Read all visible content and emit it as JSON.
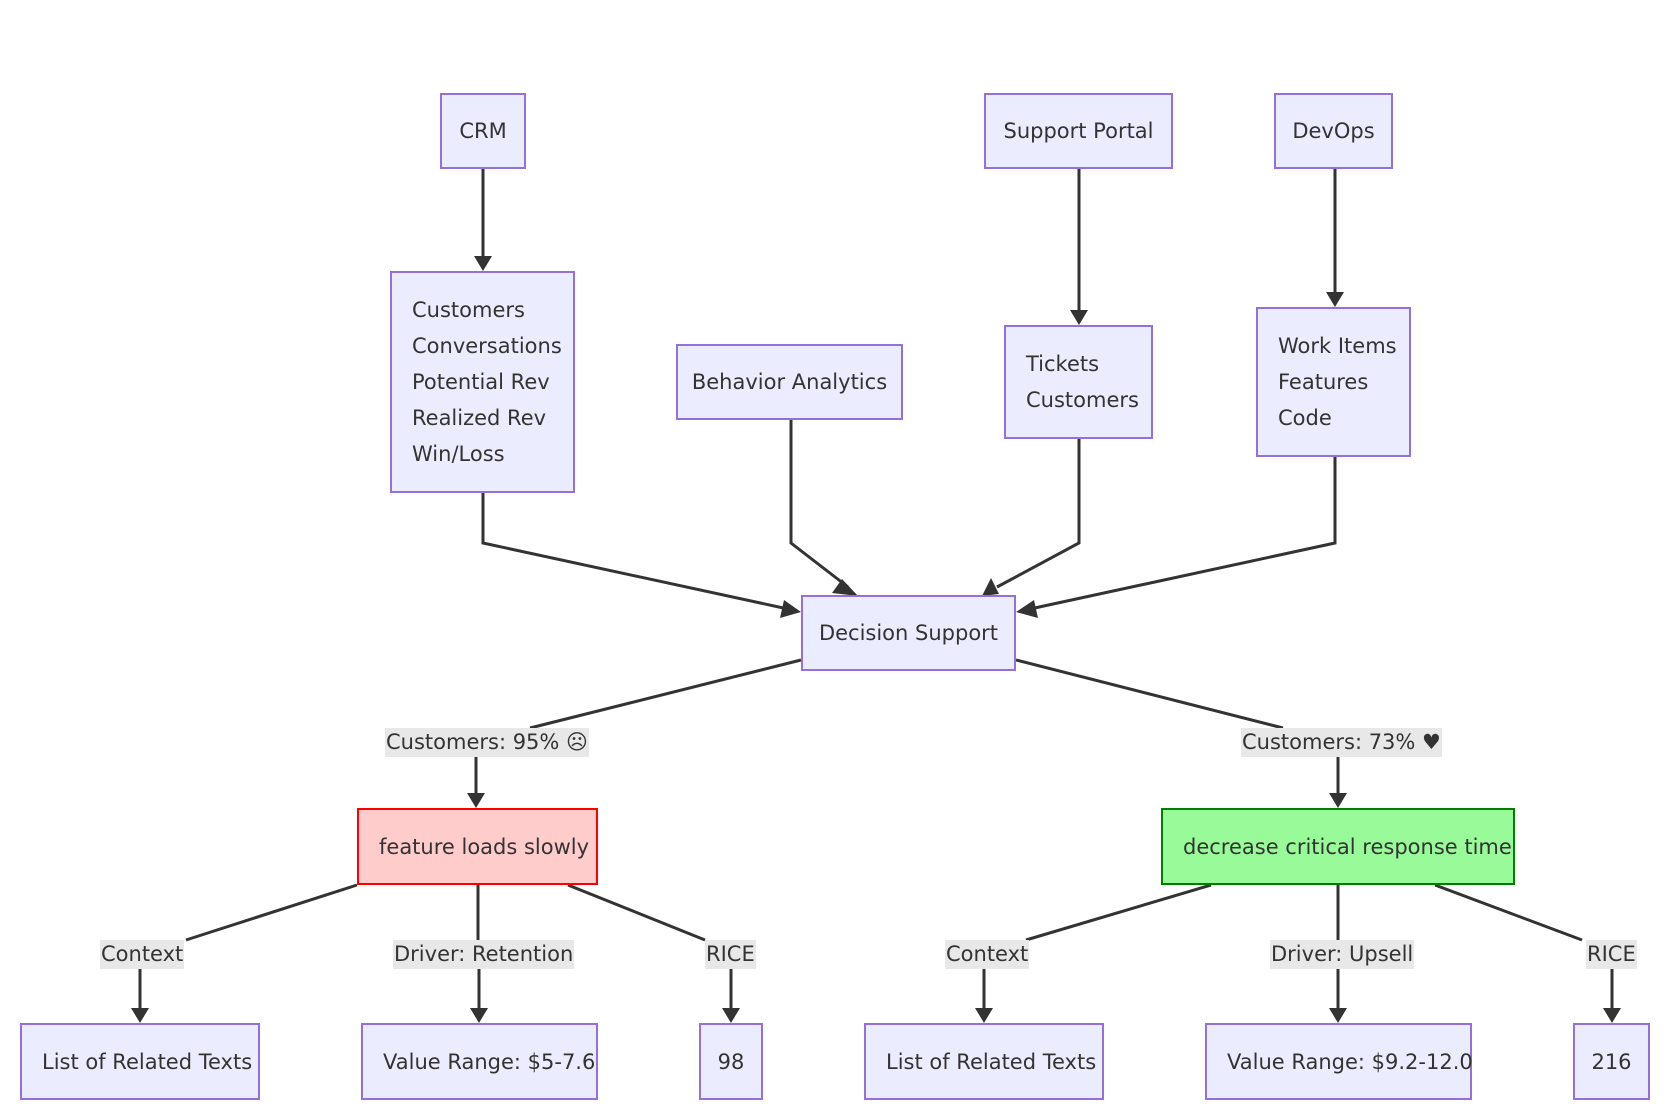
{
  "diagram": {
    "sources": {
      "crm": {
        "label": "CRM",
        "items": [
          "Customers",
          "Conversations",
          "Potential Rev",
          "Realized Rev",
          "Win/Loss"
        ]
      },
      "behavior": {
        "label": "Behavior Analytics"
      },
      "support": {
        "label": "Support Portal",
        "items": [
          "Tickets",
          "Customers"
        ]
      },
      "devops": {
        "label": "DevOps",
        "items": [
          "Work Items",
          "Features",
          "Code"
        ]
      }
    },
    "hub": {
      "label": "Decision Support"
    },
    "branches": [
      {
        "edge_label": "Customers: 95% ☹",
        "node_label": "feature loads slowly",
        "status": "negative",
        "fill": "#FFCCCC",
        "stroke": "#FF0000",
        "children": [
          {
            "edge_label": "Context",
            "node_label": "List of Related Texts"
          },
          {
            "edge_label": "Driver: Retention",
            "node_label": "Value Range: $5-7.6"
          },
          {
            "edge_label": "RICE",
            "node_label": "98"
          }
        ]
      },
      {
        "edge_label": "Customers: 73% ♥",
        "node_label": "decrease critical response time",
        "status": "positive",
        "fill": "#99FA99",
        "stroke": "#008000",
        "children": [
          {
            "edge_label": "Context",
            "node_label": "List of Related Texts"
          },
          {
            "edge_label": "Driver: Upsell",
            "node_label": "Value Range: $9.2-12.0"
          },
          {
            "edge_label": "RICE",
            "node_label": "216"
          }
        ]
      }
    ],
    "colors": {
      "node_fill": "#ECECFF",
      "node_stroke": "#9370DB",
      "edge": "#333333",
      "label_bg": "#e8e8e8"
    }
  }
}
